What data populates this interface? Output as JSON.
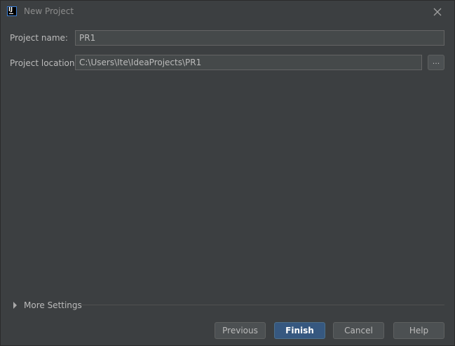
{
  "window": {
    "title": "New Project"
  },
  "form": {
    "name_label": "Project name:",
    "name_value": "PR1",
    "location_label": "Project location:",
    "location_value": "C:\\Users\\Ite\\IdeaProjects\\PR1",
    "browse_label": "..."
  },
  "more_settings": {
    "label": "More Settings",
    "expanded": false
  },
  "buttons": {
    "previous": "Previous",
    "finish": "Finish",
    "cancel": "Cancel",
    "help": "Help"
  },
  "colors": {
    "background": "#3c3f41",
    "field": "#45494a",
    "primary": "#365880"
  }
}
